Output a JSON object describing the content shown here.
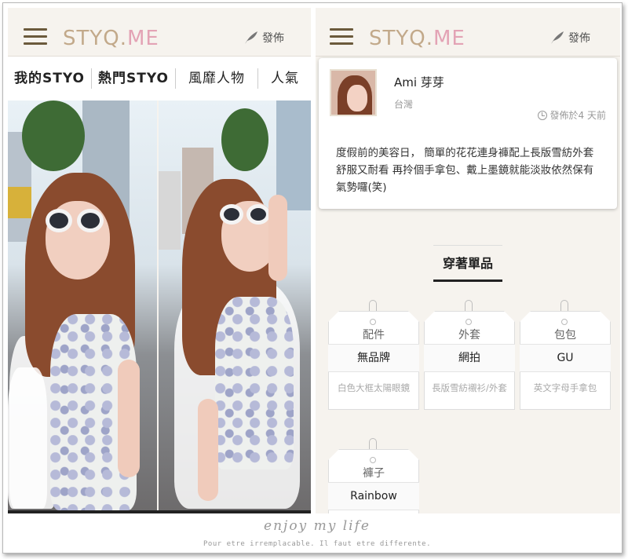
{
  "app": {
    "logo_main": "STYQ.",
    "logo_me": "ME",
    "post_label": "發佈",
    "colors": {
      "logo": "#c2a98a",
      "logo_me": "#e3a3b5",
      "menu_icon": "#6b5a3c"
    }
  },
  "left_screen": {
    "tabs": [
      {
        "label": "我的STYO"
      },
      {
        "label": "熱門STYO"
      },
      {
        "label": "風靡人物"
      },
      {
        "label": "人氣"
      }
    ]
  },
  "right_screen": {
    "post": {
      "username": "Ami 芽芽",
      "location": "台灣",
      "posted_text": "發佈於4 天前",
      "caption": "度假前的美容日， 簡單的花花連身褲配上長版雪紡外套舒服又耐看 再拎個手拿包、戴上墨鏡就能淡妝依然保有氣勢囉(笑)"
    },
    "section_title": "穿著單品",
    "items": [
      {
        "category": "配件",
        "brand": "無品牌",
        "item": "白色大框太陽眼鏡"
      },
      {
        "category": "外套",
        "brand": "網拍",
        "item": "長版雪紡襯衫/外套"
      },
      {
        "category": "包包",
        "brand": "GU",
        "item": "英文字母手拿包"
      },
      {
        "category": "褲子",
        "brand": "Rainbow",
        "item": ""
      }
    ]
  },
  "footer": {
    "signature": "enjoy my life",
    "tagline": "Pour etre irremplacable. Il faut etre differente."
  }
}
